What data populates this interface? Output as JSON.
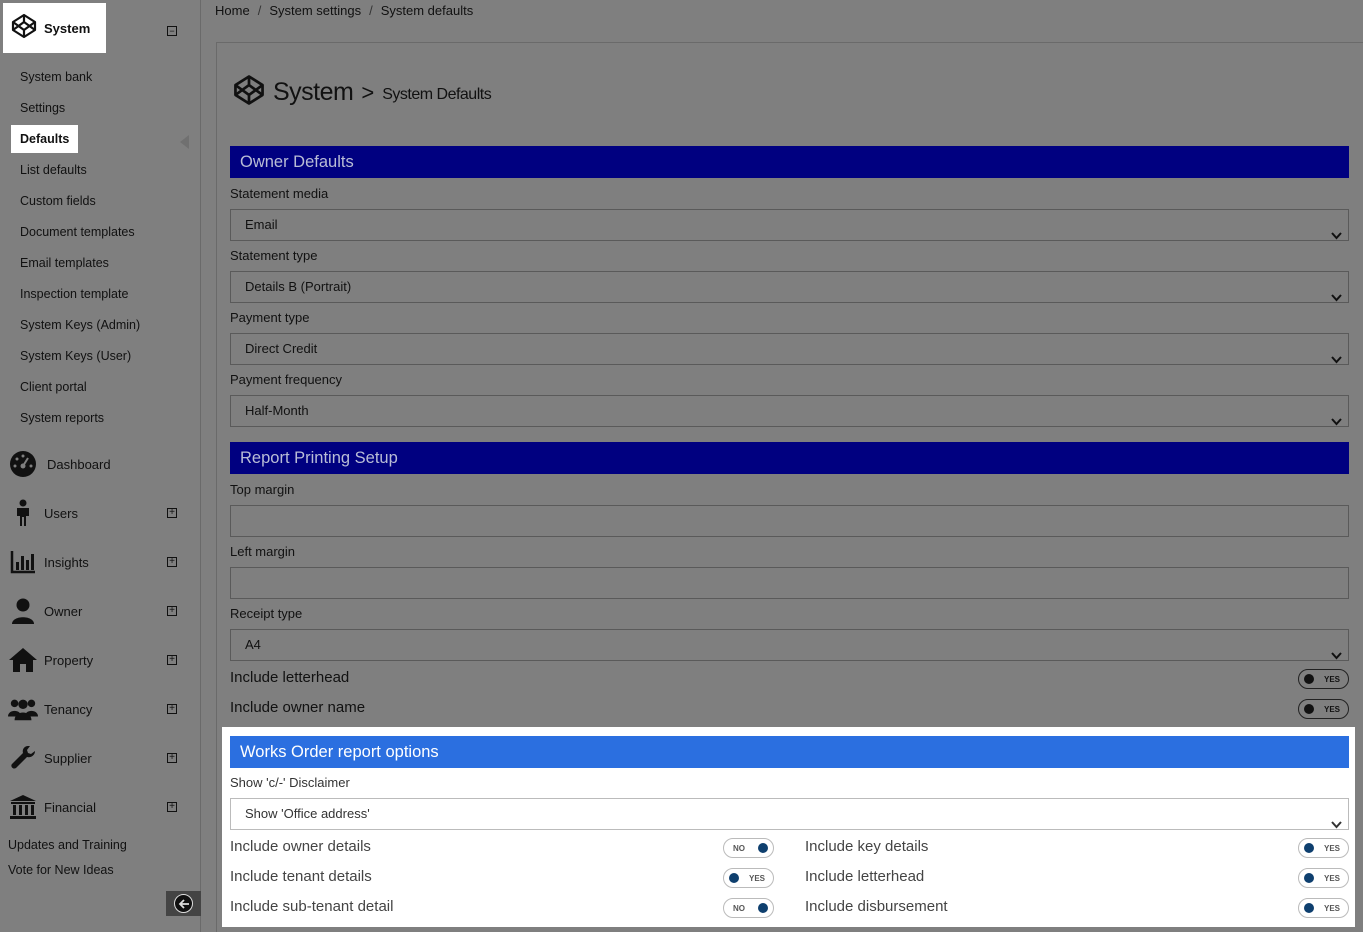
{
  "sidebar": {
    "header": {
      "label": "System"
    },
    "sub_items": [
      {
        "label": "System bank"
      },
      {
        "label": "Settings"
      },
      {
        "label": "Defaults"
      },
      {
        "label": "List defaults"
      },
      {
        "label": "Custom fields"
      },
      {
        "label": "Document templates"
      },
      {
        "label": "Email templates"
      },
      {
        "label": "Inspection template"
      },
      {
        "label": "System Keys (Admin)"
      },
      {
        "label": "System Keys (User)"
      },
      {
        "label": "Client portal"
      },
      {
        "label": "System reports"
      }
    ],
    "active_item": "Defaults",
    "nav_items": [
      {
        "label": "Dashboard",
        "icon": "dashboard-gauge-icon"
      },
      {
        "label": "Users",
        "icon": "person-icon"
      },
      {
        "label": "Insights",
        "icon": "bar-chart-icon"
      },
      {
        "label": "Owner",
        "icon": "user-icon"
      },
      {
        "label": "Property",
        "icon": "home-icon"
      },
      {
        "label": "Tenancy",
        "icon": "group-icon"
      },
      {
        "label": "Supplier",
        "icon": "wrench-icon"
      },
      {
        "label": "Financial",
        "icon": "bank-icon"
      }
    ],
    "footer_links": [
      {
        "label": "Updates and Training"
      },
      {
        "label": "Vote for New Ideas"
      }
    ]
  },
  "breadcrumb": {
    "items": [
      {
        "label": "Home"
      },
      {
        "label": "System settings"
      },
      {
        "label": "System defaults"
      }
    ],
    "separator": "/"
  },
  "page": {
    "title_main": "System",
    "title_sep": ">",
    "title_sub": "System Defaults"
  },
  "owner_defaults": {
    "heading": "Owner Defaults",
    "statement_media": {
      "label": "Statement media",
      "value": "Email"
    },
    "statement_type": {
      "label": "Statement type",
      "value": "Details B (Portrait)"
    },
    "payment_type": {
      "label": "Payment type",
      "value": "Direct Credit"
    },
    "payment_frequency": {
      "label": "Payment frequency",
      "value": "Half-Month"
    }
  },
  "report_printing": {
    "heading": "Report Printing Setup",
    "top_margin": {
      "label": "Top margin",
      "value": ""
    },
    "left_margin": {
      "label": "Left margin",
      "value": ""
    },
    "receipt_type": {
      "label": "Receipt type",
      "value": "A4"
    },
    "include_letterhead": {
      "label": "Include letterhead",
      "state": "YES"
    },
    "include_owner_name": {
      "label": "Include owner name",
      "state": "YES"
    }
  },
  "works_order": {
    "heading": "Works Order report options",
    "disclaimer": {
      "label": "Show 'c/-' Disclaimer",
      "value": "Show 'Office address'"
    },
    "toggles_left": [
      {
        "label": "Include owner details",
        "state": "NO"
      },
      {
        "label": "Include tenant details",
        "state": "YES"
      },
      {
        "label": "Include sub-tenant detail",
        "state": "NO"
      }
    ],
    "toggles_right": [
      {
        "label": "Include key details",
        "state": "YES"
      },
      {
        "label": "Include letterhead",
        "state": "YES"
      },
      {
        "label": "Include disbursement",
        "state": "YES"
      }
    ]
  },
  "colors": {
    "section_bar": "#000080",
    "works_order_bar": "#2b6fe0",
    "toggle_dot": "#0e3f6e",
    "overlay_gray": "#7f7f7f"
  }
}
